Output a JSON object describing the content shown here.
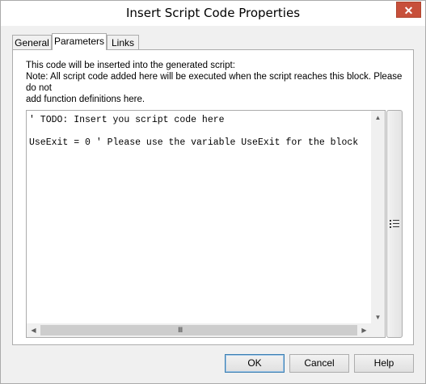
{
  "window": {
    "title": "Insert Script Code Properties",
    "close_glyph": "✕"
  },
  "tabs": [
    {
      "label": "General"
    },
    {
      "label": "Parameters"
    },
    {
      "label": "Links"
    }
  ],
  "description": {
    "line1": "This code will be inserted into the generated script:",
    "line2": "Note: All script code added here will be executed when the script reaches this block. Please do not",
    "line3": "add function definitions here."
  },
  "editor": {
    "line1": "' TODO: Insert you script code here",
    "line2": "",
    "line3": "UseExit = 0 ' Please use the variable UseExit for the block"
  },
  "buttons": {
    "ok": "OK",
    "cancel": "Cancel",
    "help": "Help"
  },
  "icons": {
    "side_button": "list-icon",
    "grip": "Ⅲ"
  }
}
